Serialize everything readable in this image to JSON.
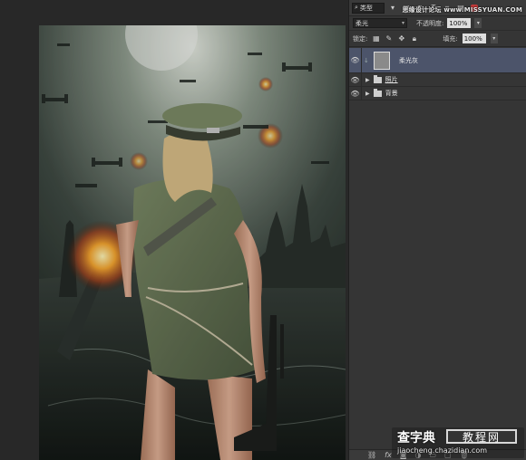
{
  "panel": {
    "search_text": "类型",
    "blend_mode": "柔光",
    "opacity_label": "不透明度:",
    "opacity_value": "100%",
    "lock_label": "锁定:",
    "fill_label": "填充:",
    "fill_value": "100%"
  },
  "layers": [
    {
      "name": "柔光灰",
      "type": "layer",
      "selected": true
    },
    {
      "name": "照片",
      "type": "group",
      "selected": false
    },
    {
      "name": "背景",
      "type": "group",
      "selected": false
    }
  ],
  "bottom_icons": [
    "link-icon",
    "fx-icon",
    "mask-icon",
    "adjustment-icon",
    "folder-icon",
    "new-layer-icon",
    "trash-icon"
  ],
  "watermark": {
    "top": "思缘设计论坛 www.MISSYUAN.COM",
    "logo": "查字典",
    "box": "教程网",
    "url": "jiaocheng.chazidian.com"
  },
  "colors": {
    "panel_bg": "#353535",
    "selected_layer": "#4c546a",
    "canvas_bg": "#282828"
  }
}
